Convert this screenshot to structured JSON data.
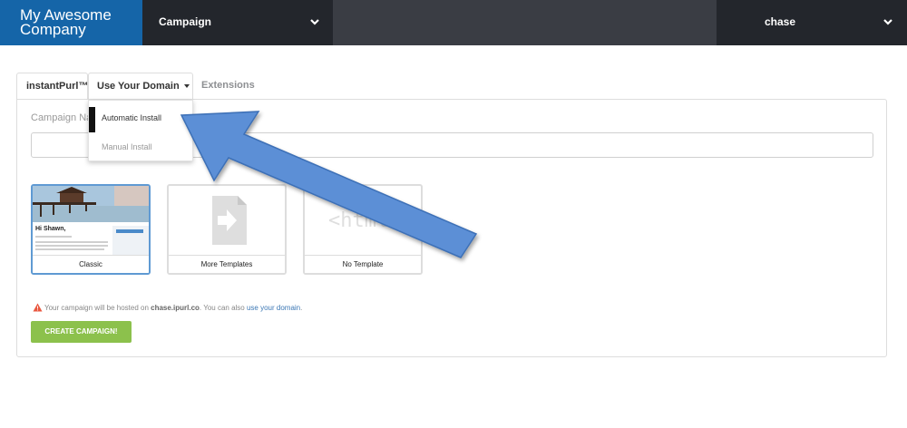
{
  "brand": {
    "line1": "My Awesome",
    "line2": "Company"
  },
  "nav": {
    "campaign": "Campaign",
    "user": "chase"
  },
  "tabs": [
    {
      "label": "instantPurl™"
    },
    {
      "label": "Use Your Domain"
    },
    {
      "label": "Extensions"
    }
  ],
  "dropdown": {
    "items": [
      "Automatic Install",
      "Manual Install"
    ]
  },
  "form": {
    "campaign_label": "Campaign Na",
    "campaign_value": ""
  },
  "templates": [
    {
      "caption": "Classic",
      "preview_text": "Hi Shawn,"
    },
    {
      "caption": "More Templates"
    },
    {
      "caption": "No Template",
      "preview_text": "<html"
    }
  ],
  "notice": {
    "prefix": "Your campaign will be hosted on",
    "domain": "chase.ipurl.co",
    "middle": ". You can also",
    "link": "use your domain",
    "suffix": "."
  },
  "create_button": "CREATE CAMPAIGN!",
  "colors": {
    "brand": "#1565a8",
    "topbar": "#3a3d44",
    "nav_dark": "#23262c",
    "accent_green": "#8cc14c",
    "arrow": "#5b8fd6",
    "link": "#3d78b5"
  }
}
